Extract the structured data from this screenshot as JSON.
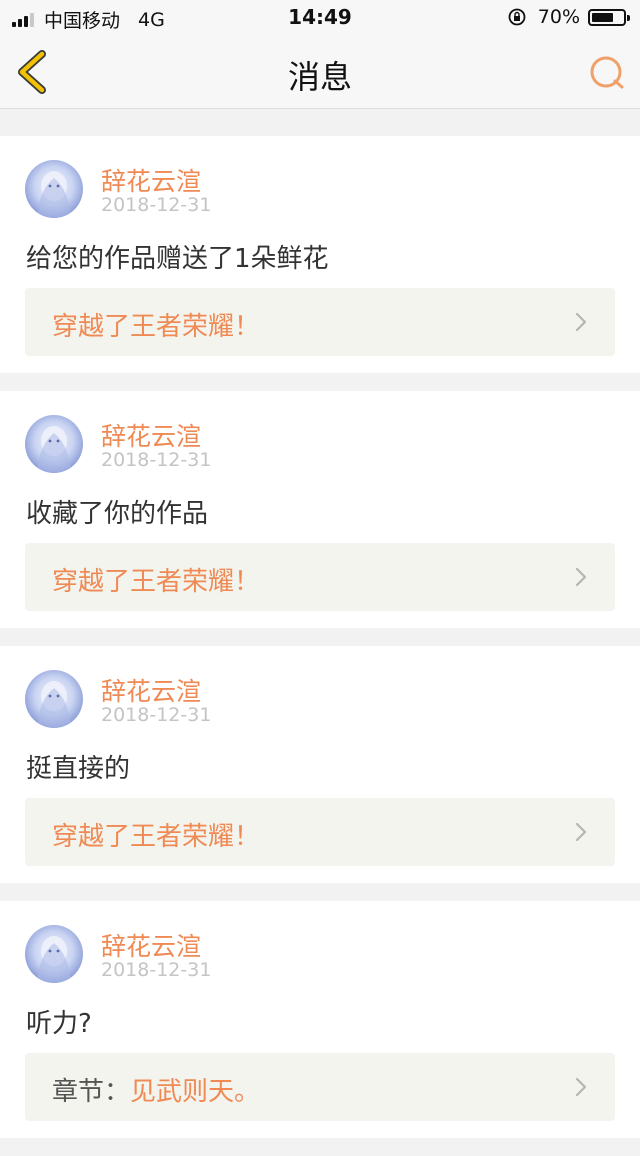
{
  "status_bar": {
    "carrier": "中国移动",
    "network": "4G",
    "time": "14:49",
    "battery_pct": "70%",
    "battery_level": 0.7
  },
  "nav": {
    "title": "消息",
    "back_icon": "chevron-left-icon",
    "search_icon": "search-icon",
    "accent_color": "#f0a06a"
  },
  "colors": {
    "accent": "#ef8a55",
    "back_icon": "#e6b800",
    "muted": "#c4c4c4"
  },
  "messages": [
    {
      "user": "辞花云渲",
      "date": "2018-12-31",
      "text": "给您的作品赠送了1朵鲜花",
      "ref_prefix": "",
      "ref_title": "穿越了王者荣耀！"
    },
    {
      "user": "辞花云渲",
      "date": "2018-12-31",
      "text": "收藏了你的作品",
      "ref_prefix": "",
      "ref_title": "穿越了王者荣耀！"
    },
    {
      "user": "辞花云渲",
      "date": "2018-12-31",
      "text": "挺直接的",
      "ref_prefix": "",
      "ref_title": "穿越了王者荣耀！"
    },
    {
      "user": "辞花云渲",
      "date": "2018-12-31",
      "text": "听力?",
      "ref_prefix": "章节：",
      "ref_title": "见武则天。"
    }
  ]
}
